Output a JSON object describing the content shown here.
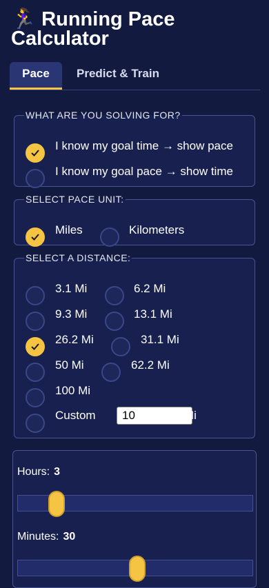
{
  "app": {
    "icon": "🏃‍♀️",
    "title": "Running Pace Calculator"
  },
  "tabs": [
    {
      "label": "Pace",
      "active": true
    },
    {
      "label": "Predict & Train",
      "active": false
    }
  ],
  "solving": {
    "legend": "WHAT ARE YOU SOLVING FOR?",
    "options": [
      {
        "label": "I know my goal time → show pace",
        "checked": true
      },
      {
        "label": "I know my goal pace → show time",
        "checked": false
      }
    ]
  },
  "pace_unit": {
    "legend": "SELECT PACE UNIT:",
    "options": [
      {
        "label": "Miles",
        "checked": true
      },
      {
        "label": "Kilometers",
        "checked": false
      }
    ]
  },
  "distance": {
    "legend": "SELECT A DISTANCE:",
    "options": [
      {
        "label": "3.1 Mi",
        "checked": false
      },
      {
        "label": "6.2 Mi",
        "checked": false
      },
      {
        "label": "9.3 Mi",
        "checked": false
      },
      {
        "label": "13.1 Mi",
        "checked": false
      },
      {
        "label": "26.2 Mi",
        "checked": true
      },
      {
        "label": "31.1 Mi",
        "checked": false
      },
      {
        "label": "50 Mi",
        "checked": false
      },
      {
        "label": "62.2 Mi",
        "checked": false
      },
      {
        "label": "100 Mi",
        "checked": false
      },
      {
        "label": "Custom",
        "checked": false
      }
    ],
    "custom_value": "10",
    "custom_unit": "Mi"
  },
  "time": {
    "hours_label": "Hours:",
    "hours": "3",
    "hours_fraction": 0.14,
    "minutes_label": "Minutes:",
    "minutes": "30",
    "minutes_fraction": 0.51
  },
  "colors": {
    "background": "#121a3f",
    "accent": "#f6c443",
    "panel": "#17204e"
  }
}
